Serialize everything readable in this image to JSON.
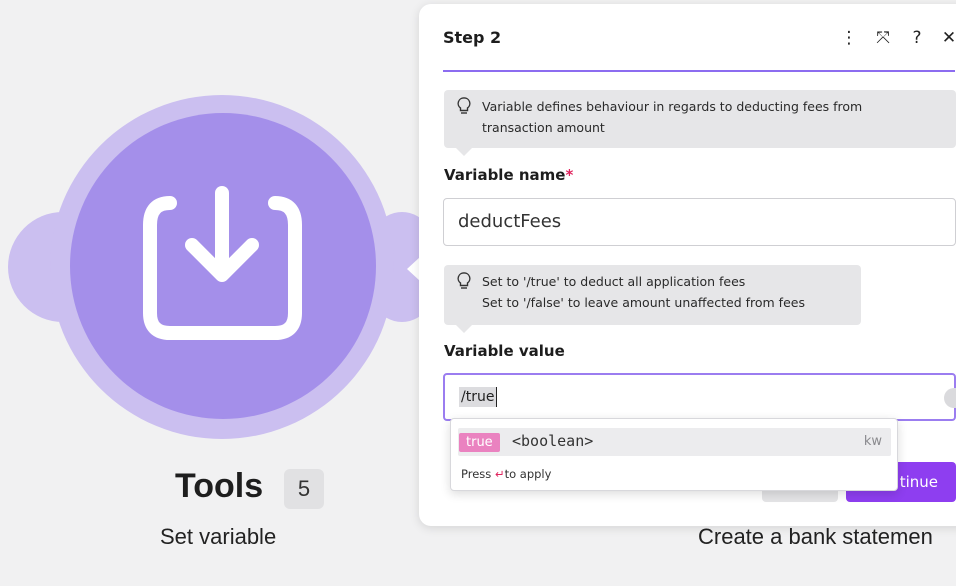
{
  "canvas": {
    "module": {
      "title": "Tools",
      "badge": "5",
      "subtitle": "Set variable",
      "icon": "download-box-icon",
      "color": "#a48fea"
    },
    "next_module": {
      "subtitle": "Create a bank statemen"
    }
  },
  "panel": {
    "title": "Step 2",
    "header_buttons": [
      {
        "name": "more-menu-icon",
        "glyph": "⋮"
      },
      {
        "name": "expand-icon",
        "glyph": "⤧"
      },
      {
        "name": "help-icon",
        "glyph": "?"
      },
      {
        "name": "close-icon",
        "glyph": "✕"
      }
    ],
    "hint_variable_name": {
      "line1": "Variable defines behaviour in regards to deducting fees from",
      "line2": "transaction amount"
    },
    "variable_name": {
      "label": "Variable name",
      "required_mark": "*",
      "value": "deductFees"
    },
    "hint_variable_value": {
      "line1": "Set to '/true' to deduct all application fees",
      "line2": "Set to '/false' to leave amount unaffected from fees"
    },
    "variable_value": {
      "label": "Variable value",
      "value": "/true"
    },
    "autocomplete": {
      "tag": "true",
      "type": "<boolean>",
      "kind": "kw",
      "help_prefix": "Press",
      "help_key": "↵",
      "help_suffix": "to apply"
    },
    "primary_button": {
      "label_visible": "tinue",
      "color": "#8e3ef0"
    }
  },
  "colors": {
    "accent": "#8c6cf0",
    "required": "#e0245e",
    "hint_bg": "#e6e6e8"
  }
}
